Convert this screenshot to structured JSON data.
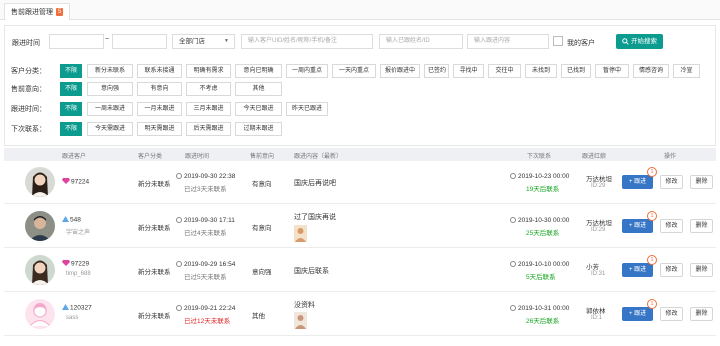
{
  "tab": {
    "title": "售前跟进管理",
    "badge": "5"
  },
  "filters": {
    "time_label": "跟进时间",
    "date_sep": "~",
    "store_select": "全部门店",
    "kw1_placeholder": "输入客户UID/姓名/昵称/手机/备注",
    "kw2_placeholder": "输入已跟姓名/ID",
    "kw3_placeholder": "输入跟进内容",
    "my_customer": "我的客户",
    "search_button": "开始搜索"
  },
  "chip_rows": [
    {
      "label": "客户分类：",
      "chips": [
        "不限",
        "新分未联系",
        "联系未接通",
        "明确有需求",
        "意向已明确",
        "一周内重点",
        "一天内重点",
        "报价跟进中",
        "已签约",
        "寻找中",
        "交往中",
        "未找到",
        "已找到",
        "暂停中",
        "情感咨询",
        "冷宣"
      ]
    },
    {
      "label": "售前意向：",
      "chips": [
        "不限",
        "意向强",
        "有意向",
        "不考虑",
        "其他"
      ]
    },
    {
      "label": "跟进时间：",
      "chips": [
        "不限",
        "一周未跟进",
        "一月未跟进",
        "三月未跟进",
        "今天已跟进",
        "昨天已跟进"
      ]
    },
    {
      "label": "下次联系：",
      "chips": [
        "不限",
        "今天需跟进",
        "明天需跟进",
        "后天需跟进",
        "过期未跟进"
      ]
    }
  ],
  "table": {
    "headers": [
      "跟进客户",
      "客户分类",
      "跟进时间",
      "售前意向",
      "跟进内容（最新）",
      "下次联系",
      "跟进红娘",
      "操作"
    ],
    "rows": [
      {
        "uid": "97224",
        "nick": "",
        "category": "新分未联系",
        "time": "2019-09-30 22:38",
        "elapsed": "已过3天未联系",
        "elapsed_alert": false,
        "intent": "有意向",
        "content": "国庆后再说吧",
        "next_time": "2019-10-23 00:00",
        "next_note": "19天后联系",
        "mm": "万达杭坦",
        "mm_id": "ID:29",
        "badge": "1",
        "level": "diamond",
        "avatar": "photo-woman-1"
      },
      {
        "uid": "548",
        "nick": "宇宙之声",
        "category": "新分未联系",
        "time": "2019-09-30 17:11",
        "elapsed": "已过4天未联系",
        "elapsed_alert": false,
        "intent": "有意向",
        "content": "过了国庆再说",
        "next_time": "2019-10-30 00:00",
        "next_note": "25天后联系",
        "mm": "万达杭坦",
        "mm_id": "ID:29",
        "badge": "1",
        "level": "triangle",
        "avatar": "photo-man"
      },
      {
        "uid": "97229",
        "nick": "timp_688",
        "category": "新分未联系",
        "time": "2019-09-29 16:54",
        "elapsed": "已过5天未联系",
        "elapsed_alert": false,
        "intent": "意向强",
        "content": "国庆后联系",
        "next_time": "2019-10-10 00:00",
        "next_note": "5天后联系",
        "mm": "小芳",
        "mm_id": "ID:31",
        "badge": "1",
        "level": "diamond",
        "avatar": "photo-woman-2"
      },
      {
        "uid": "120327",
        "nick": "sass",
        "category": "新分未联系",
        "time": "2019-09-21 22:24",
        "elapsed": "已过12天未联系",
        "elapsed_alert": true,
        "intent": "其他",
        "content": "没资料",
        "next_time": "2019-10-31 00:00",
        "next_note": "26天后联系",
        "mm": "郭依林",
        "mm_id": "ID:1",
        "badge": "1",
        "level": "triangle",
        "avatar": "default-female"
      }
    ],
    "follow_label": "+ 跟进",
    "edit_label": "修改",
    "delete_label": "删除"
  },
  "colors": {
    "accent": "#0b9c8f",
    "follow": "#3776c6",
    "badge": "#f06f3c",
    "green": "#14a51e",
    "red": "#e02828",
    "diamond": "#e0439d",
    "triangle": "#5da7e8"
  }
}
